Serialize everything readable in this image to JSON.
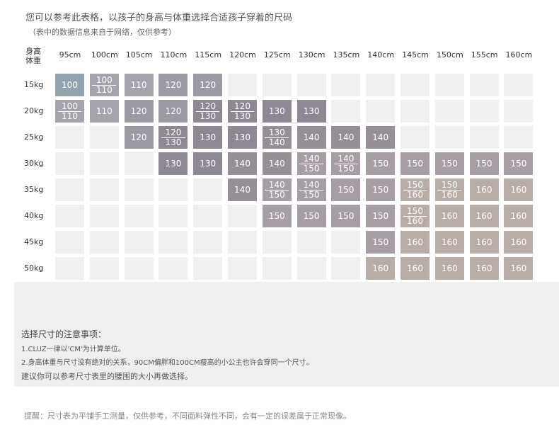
{
  "header": {
    "title": "您可以参考此表格，以孩子的身高与体重选择合适孩子穿着的尺码",
    "subtitle": "（表中的数据信息来自于网络，仅供参考）"
  },
  "table": {
    "corner_top": "身高",
    "corner_bottom": "体重",
    "heights": [
      "95cm",
      "100cm",
      "105cm",
      "110cm",
      "115cm",
      "120cm",
      "125cm",
      "130cm",
      "135cm",
      "140cm",
      "145cm",
      "150cm",
      "155cm",
      "160cm"
    ],
    "weights": [
      "15kg",
      "20kg",
      "25kg",
      "30kg",
      "35kg",
      "40kg",
      "45kg",
      "50kg"
    ],
    "cells": [
      [
        "100",
        "100/110",
        "110",
        "120",
        "120",
        "",
        "",
        "",
        "",
        "",
        "",
        "",
        "",
        ""
      ],
      [
        "100/110",
        "110",
        "120",
        "120",
        "120/130",
        "120/130",
        "130",
        "130",
        "",
        "",
        "",
        "",
        "",
        ""
      ],
      [
        "",
        "",
        "120",
        "120/130",
        "130",
        "130",
        "130/140",
        "140",
        "140",
        "140",
        "",
        "",
        "",
        ""
      ],
      [
        "",
        "",
        "",
        "130",
        "130",
        "140",
        "140",
        "140/150",
        "140/150",
        "150",
        "150",
        "150",
        "150",
        "150"
      ],
      [
        "",
        "",
        "",
        "",
        "",
        "140",
        "140/150",
        "140/150",
        "150",
        "150",
        "150/160",
        "150/160",
        "160",
        "160"
      ],
      [
        "",
        "",
        "",
        "",
        "",
        "",
        "150",
        "150",
        "150",
        "150",
        "150/160",
        "160",
        "160",
        "160"
      ],
      [
        "",
        "",
        "",
        "",
        "",
        "",
        "",
        "",
        "",
        "150",
        "160",
        "160",
        "160",
        "160"
      ],
      [
        "",
        "",
        "",
        "",
        "",
        "",
        "",
        "",
        "",
        "160",
        "160",
        "160",
        "160",
        "160"
      ]
    ],
    "colors": {
      "100": "#93a2ac",
      "110": "#a4a5ac",
      "120": "#9d9aa5",
      "130": "#8e8894",
      "140": "#968f96",
      "150": "#a69ea4",
      "160": "#b7aca6",
      "empty": "#efefef"
    }
  },
  "notes": {
    "title": "选择尺寸的注意事项：",
    "line1": "1.CLUZ一律以'CM'为计算单位。",
    "line2": "2.身高体重与尺寸没有绝对的关系，90CM偏胖和100CM瘦高的小公主也许会穿同一个尺寸。",
    "line3": "建议你可以参考尺寸表里的腰围的大小再做选择。"
  },
  "reminder": "提醒：尺寸表为平铺手工测量，仅供参考，不同面料弹性不同，会有一定的误差属于正常现像。"
}
